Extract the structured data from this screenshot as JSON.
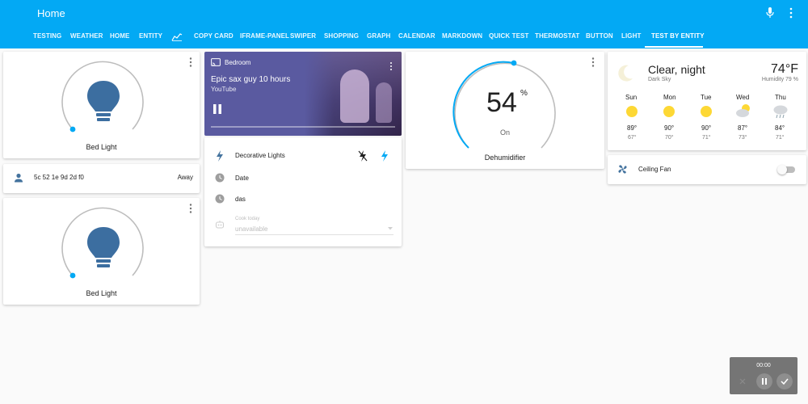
{
  "header": {
    "title": "Home",
    "tabs": [
      {
        "label": "TESTING"
      },
      {
        "label": "WEATHER"
      },
      {
        "label": "HOME"
      },
      {
        "label": "ENTITY"
      },
      {
        "label": ""
      },
      {
        "label": "COPY CARD"
      },
      {
        "label": "IFRAME-PANEL"
      },
      {
        "label": "SWIPER"
      },
      {
        "label": "SHOPPING"
      },
      {
        "label": "GRAPH"
      },
      {
        "label": "CALENDAR"
      },
      {
        "label": "MARKDOWN"
      },
      {
        "label": "QUICK TEST"
      },
      {
        "label": "THERMOSTAT"
      },
      {
        "label": "BUTTON"
      },
      {
        "label": "LIGHT"
      },
      {
        "label": "TEST BY ENTITY"
      }
    ],
    "active_tab": "TEST BY ENTITY"
  },
  "colors": {
    "primary": "#03a9f4",
    "bulb": "#3c6ea0",
    "icon_blue": "#44739e",
    "active_blue": "#03a9f4"
  },
  "light_top": {
    "name": "Bed Light"
  },
  "light_bottom": {
    "name": "Bed Light"
  },
  "person_row": {
    "id": "5c 52 1e 9d 2d f0",
    "state": "Away"
  },
  "media": {
    "device": "Bedroom",
    "title": "Epic sax guy 10 hours",
    "app": "YouTube"
  },
  "entities": {
    "rows": [
      {
        "label": "Decorative Lights",
        "icon": "flash-icon"
      },
      {
        "label": "Date",
        "icon": "clock-icon"
      },
      {
        "label": "das",
        "icon": "clock-icon"
      }
    ],
    "input": {
      "label": "Cook today",
      "value": "unavailable"
    }
  },
  "thermo": {
    "value": "54",
    "unit": "%",
    "state": "On",
    "name": "Dehumidifier"
  },
  "weather": {
    "condition": "Clear, night",
    "provider": "Dark Sky",
    "temp": "74°F",
    "humidity": "Humidity 79 %",
    "days": [
      {
        "day": "Sun",
        "high": "89°",
        "low": "67°",
        "icon": "sunny-icon"
      },
      {
        "day": "Mon",
        "high": "90°",
        "low": "70°",
        "icon": "sunny-icon"
      },
      {
        "day": "Tue",
        "high": "90°",
        "low": "71°",
        "icon": "sunny-icon"
      },
      {
        "day": "Wed",
        "high": "87°",
        "low": "73°",
        "icon": "partly-cloudy-icon"
      },
      {
        "day": "Thu",
        "high": "84°",
        "low": "71°",
        "icon": "rain-icon"
      }
    ]
  },
  "fan": {
    "name": "Ceiling Fan"
  },
  "toast": {
    "time": "00:00"
  }
}
